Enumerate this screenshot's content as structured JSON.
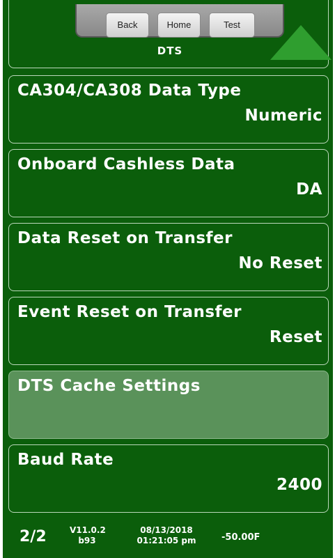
{
  "toolbar": {
    "back_label": "Back",
    "home_label": "Home",
    "test_label": "Test"
  },
  "header": {
    "title": "DTS"
  },
  "items": [
    {
      "label": "CA304/CA308 Data Type",
      "value": "Numeric"
    },
    {
      "label": "Onboard Cashless Data",
      "value": "DA"
    },
    {
      "label": "Data Reset on Transfer",
      "value": "No Reset"
    },
    {
      "label": "Event Reset on Transfer",
      "value": "Reset"
    },
    {
      "label": "DTS Cache Settings",
      "value": ""
    },
    {
      "label": "Baud Rate",
      "value": "2400"
    }
  ],
  "status": {
    "page": "2/2",
    "version": "V11.0.2",
    "build": "b93",
    "date": "08/13/2018",
    "time": "01:21:05 pm",
    "temperature": "-50.00F"
  },
  "colors": {
    "background": "#0b5e0b",
    "highlight": "#5a925a",
    "arrow": "#2f9e2f"
  }
}
